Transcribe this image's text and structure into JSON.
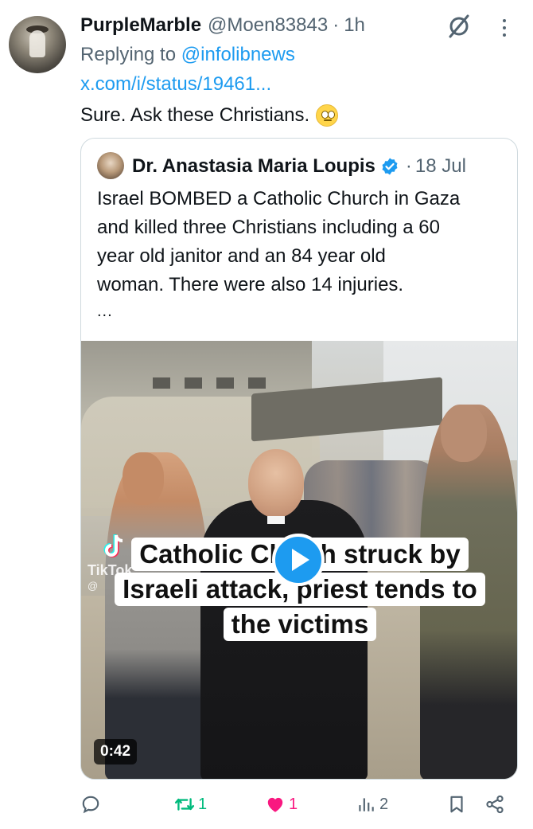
{
  "post": {
    "display_name": "PurpleMarble",
    "handle": "@Moen83843",
    "separator": "·",
    "time": "1h",
    "replying_prefix": "Replying to ",
    "replying_to": "@infolibnews",
    "link": "x.com/i/status/19461...",
    "text": "Sure. Ask these Christians."
  },
  "quote": {
    "display_name": "Dr. Anastasia Maria Loupis",
    "separator": "·",
    "date": "18 Jul",
    "lines": [
      "Israel BOMBED a Catholic Church in Gaza",
      "and killed three Christians including a 60",
      "year old janitor and an 84 year old",
      "woman. There were also 14 injuries."
    ],
    "ellipsis": "...",
    "video": {
      "caption_lines": [
        "Catholic Cl      h struck by",
        "Israeli attack, priest tends to",
        "the victims"
      ],
      "watermark": "TikTok",
      "watermark_user": "@",
      "duration": "0:42"
    }
  },
  "actions": {
    "retweets": "1",
    "likes": "1",
    "views": "2"
  },
  "colors": {
    "accent": "#1d9bf0",
    "retweet": "#00ba7c",
    "like": "#f91880",
    "muted": "#536471"
  }
}
